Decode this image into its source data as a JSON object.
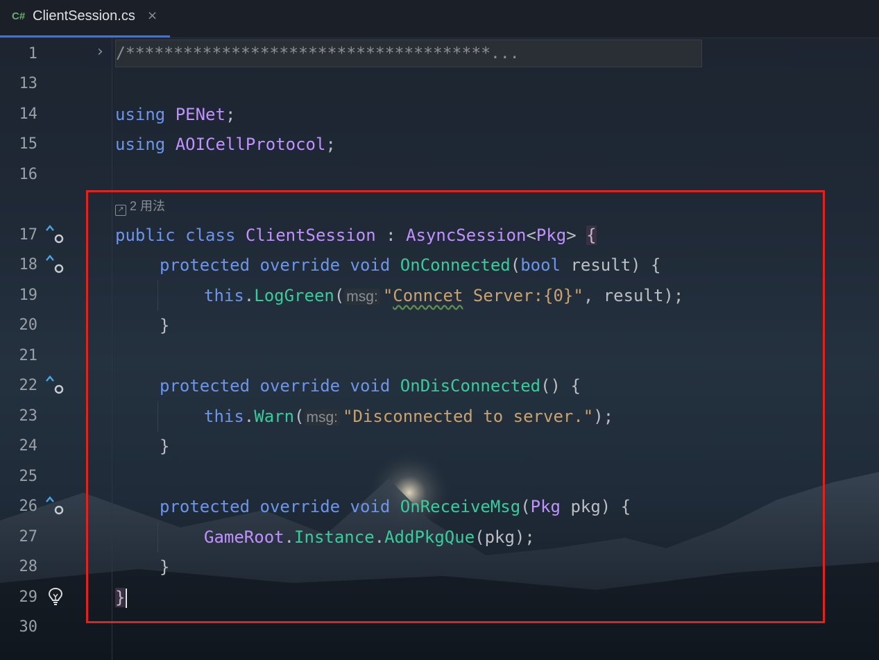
{
  "tab": {
    "lang_badge": "C#",
    "title": "ClientSession.cs",
    "close": "×"
  },
  "folded": {
    "line": "1",
    "text": "/**************************************...",
    "arrow": "›"
  },
  "usages": {
    "icon": "↗",
    "label": "2 用法"
  },
  "lines": [
    {
      "n": "1"
    },
    {
      "n": "13"
    },
    {
      "n": "14"
    },
    {
      "n": "15"
    },
    {
      "n": "16"
    },
    {
      "n": "17"
    },
    {
      "n": "18"
    },
    {
      "n": "19"
    },
    {
      "n": "20"
    },
    {
      "n": "21"
    },
    {
      "n": "22"
    },
    {
      "n": "23"
    },
    {
      "n": "24"
    },
    {
      "n": "25"
    },
    {
      "n": "26"
    },
    {
      "n": "27"
    },
    {
      "n": "28"
    },
    {
      "n": "29"
    },
    {
      "n": "30"
    }
  ],
  "code": {
    "l14": {
      "kw": "using",
      "name": "PENet",
      "end": ";"
    },
    "l15": {
      "kw": "using",
      "name": "AOICellProtocol",
      "end": ";"
    },
    "l17": {
      "kw1": "public",
      "kw2": "class",
      "name": "ClientSession",
      "colon": " : ",
      "base": "AsyncSession",
      "lt": "<",
      "arg": "Pkg",
      "gt": ">",
      "brace": "{"
    },
    "l18": {
      "kw1": "protected",
      "kw2": "override",
      "kw3": "void",
      "fn": "OnConnected",
      "open": "(",
      "ptype": "bool",
      "pname": " result",
      "close": ") {"
    },
    "l19": {
      "this": "this",
      "dot": ".",
      "fn": "LogGreen",
      "open": "(",
      "hint": "msg:",
      "str1": "\"",
      "typo": "Conncet",
      "str2": " Server:{0}\"",
      "rest": ", result);"
    },
    "l20": {
      "text": "}"
    },
    "l22": {
      "kw1": "protected",
      "kw2": "override",
      "kw3": "void",
      "fn": "OnDisConnected",
      "rest": "() {"
    },
    "l23": {
      "this": "this",
      "dot": ".",
      "fn": "Warn",
      "open": "(",
      "hint": "msg:",
      "str": "\"Disconnected to server.\"",
      "rest": ");"
    },
    "l24": {
      "text": "}"
    },
    "l26": {
      "kw1": "protected",
      "kw2": "override",
      "kw3": "void",
      "fn": "OnReceiveMsg",
      "open": "(",
      "ptype": "Pkg",
      "pname": " pkg",
      "close": ") {"
    },
    "l27": {
      "obj": "GameRoot",
      "dot1": ".",
      "prop": "Instance",
      "dot2": ".",
      "fn": "AddPkgQue",
      "rest": "(pkg);"
    },
    "l28": {
      "text": "}"
    },
    "l29": {
      "text": "}"
    }
  },
  "colors": {
    "keyword": "#6c95eb",
    "class": "#c191ff",
    "method": "#39cc9b",
    "string": "#c9a26d",
    "highlight_box": "#e0231f",
    "tab_underline": "#3574f0"
  }
}
